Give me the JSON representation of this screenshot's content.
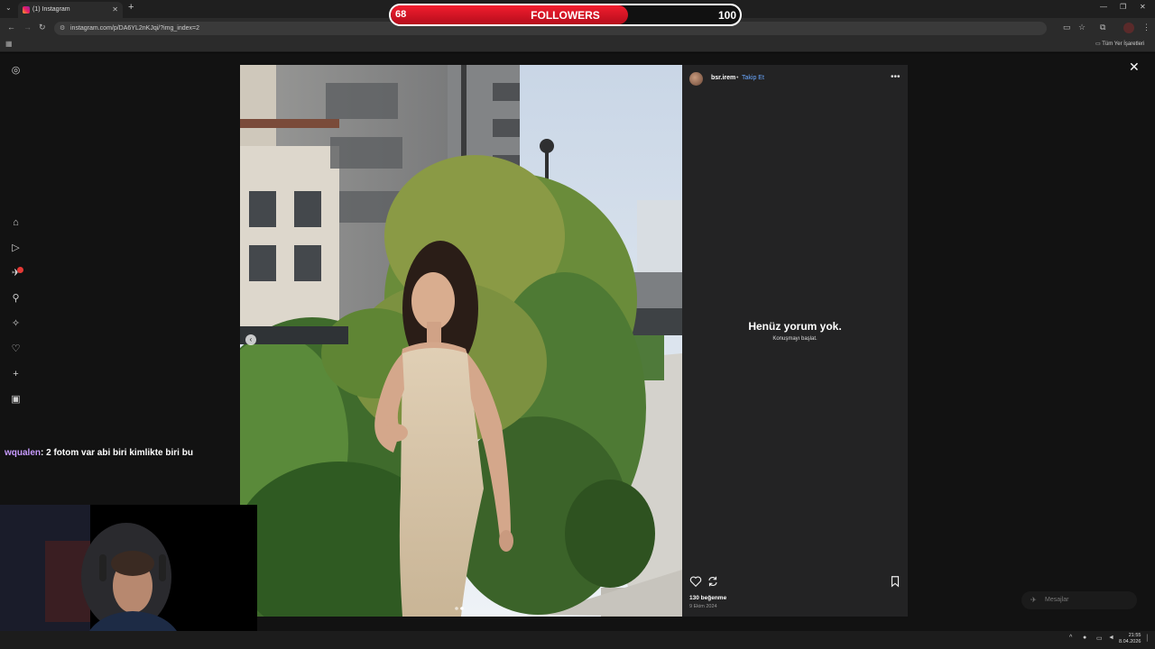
{
  "browser": {
    "tab_title": "(1) Instagram",
    "url": "instagram.com/p/DA6YL2nKJqi/?img_index=2",
    "bookmarks_label": "Tüm Yer İşaretleri"
  },
  "overlay": {
    "followers_current": "68",
    "followers_label": "FOLLOWERS",
    "followers_goal": "100",
    "progress": 0.68
  },
  "post": {
    "username": "bsr.irem",
    "separator": "•",
    "follow_label": "Takip Et",
    "no_comments": "Henüz yorum yok.",
    "start_conversation": "Konuşmayı başlat.",
    "likes": "130 beğenme",
    "date": "9 Ekim 2024"
  },
  "chat": {
    "user": "wqualen",
    "message": ": 2 fotom var abi biri kimlikte biri bu"
  },
  "messages_label": "Mesajlar",
  "taskbar": {
    "time": "21:55",
    "date": "8.04.2026"
  },
  "colors": {
    "accent_red": "#e31b2b",
    "link_blue": "#6aa8ff",
    "chat_user": "#c89bff"
  }
}
